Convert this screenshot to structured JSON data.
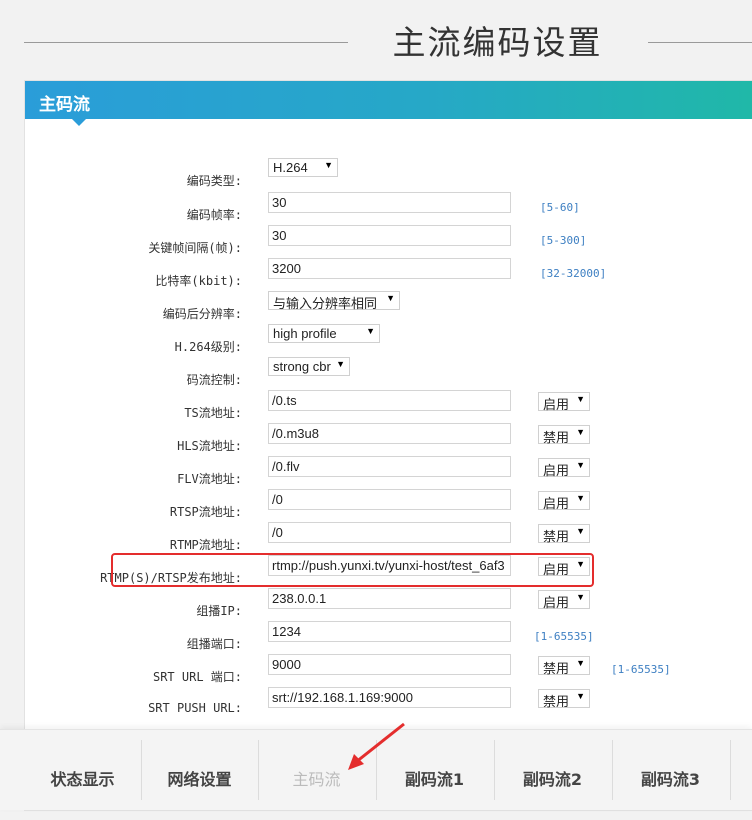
{
  "header": {
    "title": "主流编码设置"
  },
  "panel": {
    "title": "主码流"
  },
  "rows": [
    {
      "label": "编码类型:",
      "select": "H.264",
      "select_w": 70
    },
    {
      "label": "编码帧率:",
      "input": "30",
      "hint": "[5-60]"
    },
    {
      "label": "关键帧间隔(帧):",
      "input": "30",
      "hint": "[5-300]"
    },
    {
      "label": "比特率(kbit):",
      "input": "3200",
      "hint": "[32-32000]"
    },
    {
      "label": "编码后分辨率:",
      "select": "与输入分辨率相同",
      "select_w": 132
    },
    {
      "label": "H.264级别:",
      "select": "high profile",
      "select_w": 112
    },
    {
      "label": "码流控制:",
      "select": "strong cbr",
      "select_w": 82
    },
    {
      "label": "TS流地址:",
      "input": "/0.ts",
      "control": "启用"
    },
    {
      "label": "HLS流地址:",
      "input": "/0.m3u8",
      "control": "禁用"
    },
    {
      "label": "FLV流地址:",
      "input": "/0.flv",
      "control": "启用"
    },
    {
      "label": "RTSP流地址:",
      "input": "/0",
      "control": "启用"
    },
    {
      "label": "RTMP流地址:",
      "input": "/0",
      "control": "禁用"
    },
    {
      "label": "RTMP(S)/RTSP发布地址:",
      "input": "rtmp://push.yunxi.tv/yunxi-host/test_6af3",
      "control": "启用"
    },
    {
      "label": "组播IP:",
      "input": "238.0.0.1",
      "control": "启用"
    },
    {
      "label": "组播端口:",
      "input": "1234",
      "hint": "[1-65535]"
    },
    {
      "label": "SRT URL 端口:",
      "input": "9000",
      "control": "禁用",
      "hint": "[1-65535]"
    },
    {
      "label": "SRT PUSH URL:",
      "input": "srt://192.168.1.169:9000",
      "control": "禁用"
    }
  ],
  "tabs": [
    "状态显示",
    "网络设置",
    "主码流",
    "副码流1",
    "副码流2",
    "副码流3"
  ],
  "active_tab": 2,
  "colors": {
    "accent_start": "#2a9dd9",
    "accent_end": "#20b8a8",
    "highlight": "#e42d2d",
    "hint": "#3d7fc2"
  }
}
